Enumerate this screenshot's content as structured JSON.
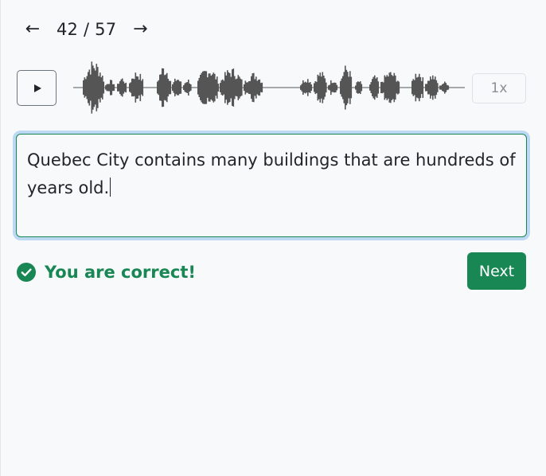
{
  "pager": {
    "prev_icon": "←",
    "next_icon": "→",
    "counter": "42 / 57"
  },
  "audio": {
    "play_icon": "play-icon",
    "speed": "1x"
  },
  "answer": {
    "line1": "Quebec City contains many buildings that are hundreds of",
    "line2": "years old."
  },
  "feedback": {
    "message": "You are correct!",
    "icon": "check-circle-icon"
  },
  "next_button": {
    "label": "Next"
  },
  "colors": {
    "success": "#198754",
    "waveform": "#555555",
    "focus_ring": "#bcd8f3"
  }
}
